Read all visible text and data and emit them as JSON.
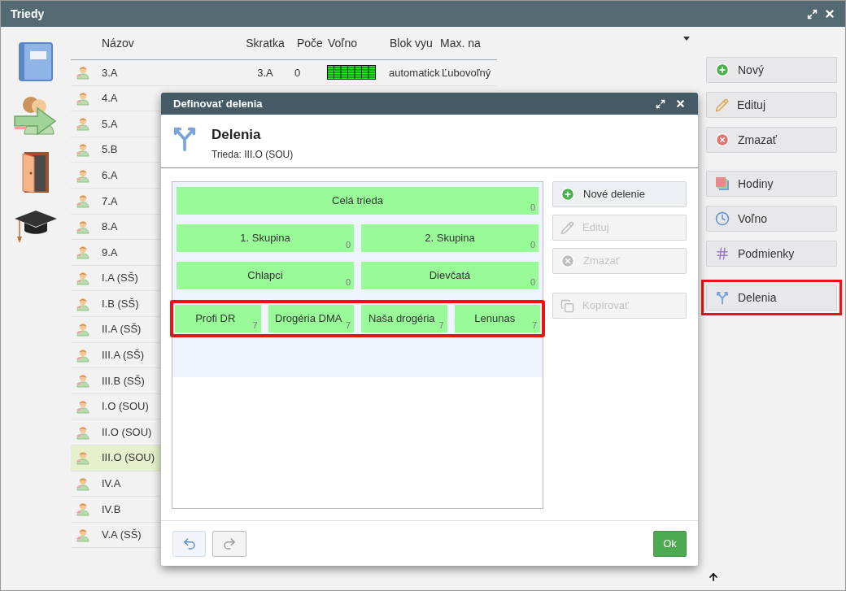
{
  "window": {
    "title": "Triedy"
  },
  "table": {
    "columns": [
      "Názov",
      "Skratka",
      "Poče",
      "Voľno",
      "Blok vyu",
      "Max. na"
    ],
    "rows": [
      {
        "name": "3.A",
        "selected": false,
        "details": {
          "short": "3.A",
          "count": "0",
          "block": "automatick",
          "max": "Ľubovoľný"
        }
      },
      {
        "name": "4.A",
        "selected": false
      },
      {
        "name": "5.A",
        "selected": false
      },
      {
        "name": "5.B",
        "selected": false
      },
      {
        "name": "6.A",
        "selected": false
      },
      {
        "name": "7.A",
        "selected": false
      },
      {
        "name": "8.A",
        "selected": false
      },
      {
        "name": "9.A",
        "selected": false
      },
      {
        "name": "I.A (SŠ)",
        "selected": false
      },
      {
        "name": "I.B (SŠ)",
        "selected": false
      },
      {
        "name": "II.A (SŠ)",
        "selected": false
      },
      {
        "name": "III.A (SŠ)",
        "selected": false
      },
      {
        "name": "III.B (SŠ)",
        "selected": false
      },
      {
        "name": "I.O (SOU)",
        "selected": false
      },
      {
        "name": "II.O (SOU)",
        "selected": false
      },
      {
        "name": "III.O (SOU)",
        "selected": true
      },
      {
        "name": "IV.A",
        "selected": false
      },
      {
        "name": "IV.B",
        "selected": false
      },
      {
        "name": "V.A (SŠ)",
        "selected": false
      }
    ]
  },
  "side_button_groups": [
    [
      {
        "label": "Nový",
        "kind": "add",
        "highlighted": false
      },
      {
        "label": "Edituj",
        "kind": "edit",
        "highlighted": false
      },
      {
        "label": "Zmazať",
        "kind": "delete",
        "highlighted": false
      }
    ],
    [
      {
        "label": "Hodiny",
        "kind": "hours",
        "highlighted": false
      },
      {
        "label": "Voľno",
        "kind": "free",
        "highlighted": false
      },
      {
        "label": "Podmienky",
        "kind": "conditions",
        "highlighted": false
      }
    ],
    [
      {
        "label": "Delenia",
        "kind": "divisions",
        "highlighted": true
      }
    ]
  ],
  "dialog": {
    "title": "Definovať delenia",
    "heading": "Delenia",
    "subtitle": "Trieda: III.O (SOU)",
    "divisions": [
      {
        "highlighted": false,
        "groups": [
          {
            "name": "Celá trieda",
            "count": "0"
          }
        ]
      },
      {
        "highlighted": false,
        "groups": [
          {
            "name": "1. Skupina",
            "count": "0"
          },
          {
            "name": "2. Skupina",
            "count": "0"
          }
        ]
      },
      {
        "highlighted": false,
        "groups": [
          {
            "name": "Chlapci",
            "count": "0"
          },
          {
            "name": "Dievčatá",
            "count": "0"
          }
        ]
      },
      {
        "highlighted": true,
        "groups": [
          {
            "name": "Profi DR",
            "count": "7"
          },
          {
            "name": "Drogéria DMA",
            "count": "7"
          },
          {
            "name": "Naša drogéria",
            "count": "7"
          },
          {
            "name": "Lenunas",
            "count": "7"
          }
        ]
      }
    ],
    "action_groups": [
      [
        {
          "label": "Nové delenie",
          "kind": "add",
          "disabled": false
        },
        {
          "label": "Edituj",
          "kind": "edit",
          "disabled": true
        },
        {
          "label": "Zmazať",
          "kind": "delete",
          "disabled": true
        }
      ],
      [
        {
          "label": "Kopírovať",
          "kind": "copy",
          "disabled": true
        }
      ]
    ],
    "undo": {
      "disabled": false
    },
    "redo": {
      "disabled": true
    },
    "ok": "Ok"
  }
}
